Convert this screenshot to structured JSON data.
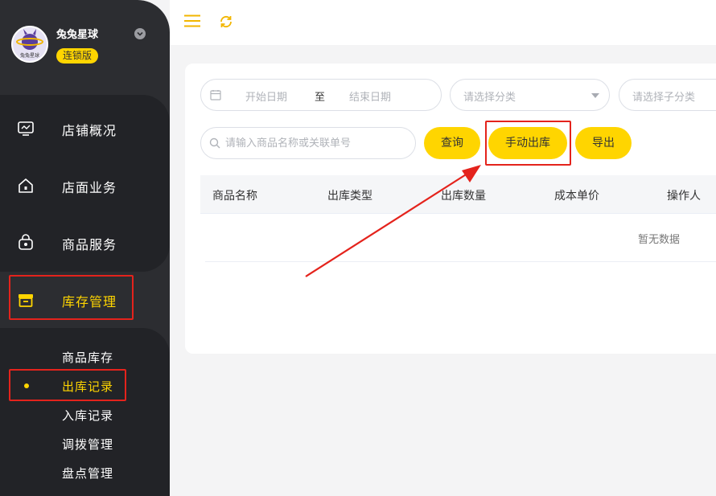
{
  "shop": {
    "name": "兔兔星球",
    "edition": "连锁版",
    "avatar_text": "兔兔星球"
  },
  "nav": {
    "items": [
      {
        "label": "店铺概况",
        "icon": "monitor-icon"
      },
      {
        "label": "店面业务",
        "icon": "home-icon"
      },
      {
        "label": "商品服务",
        "icon": "bag-icon"
      },
      {
        "label": "库存管理",
        "icon": "box-icon"
      }
    ],
    "sub_items": [
      "商品库存",
      "出库记录",
      "入库记录",
      "调拨管理",
      "盘点管理"
    ],
    "active_item": "库存管理",
    "active_sub_item": "出库记录"
  },
  "header": {
    "menu_icon": "hamburger-icon",
    "refresh_icon": "refresh-icon"
  },
  "filters": {
    "start_date_placeholder": "开始日期",
    "range_separator": "至",
    "end_date_placeholder": "结束日期",
    "category_placeholder": "请选择分类",
    "subcategory_placeholder": "请选择子分类",
    "search_placeholder": "请输入商品名称或关联单号"
  },
  "buttons": {
    "query": "查询",
    "manual_outbound": "手动出库",
    "export": "导出"
  },
  "table": {
    "columns": [
      "商品名称",
      "出库类型",
      "出库数量",
      "成本单价",
      "操作人"
    ],
    "empty_text": "暂无数据"
  },
  "colors": {
    "accent": "#ffd500",
    "sidebar": "#2c2d31",
    "annotation": "#e4231c"
  }
}
